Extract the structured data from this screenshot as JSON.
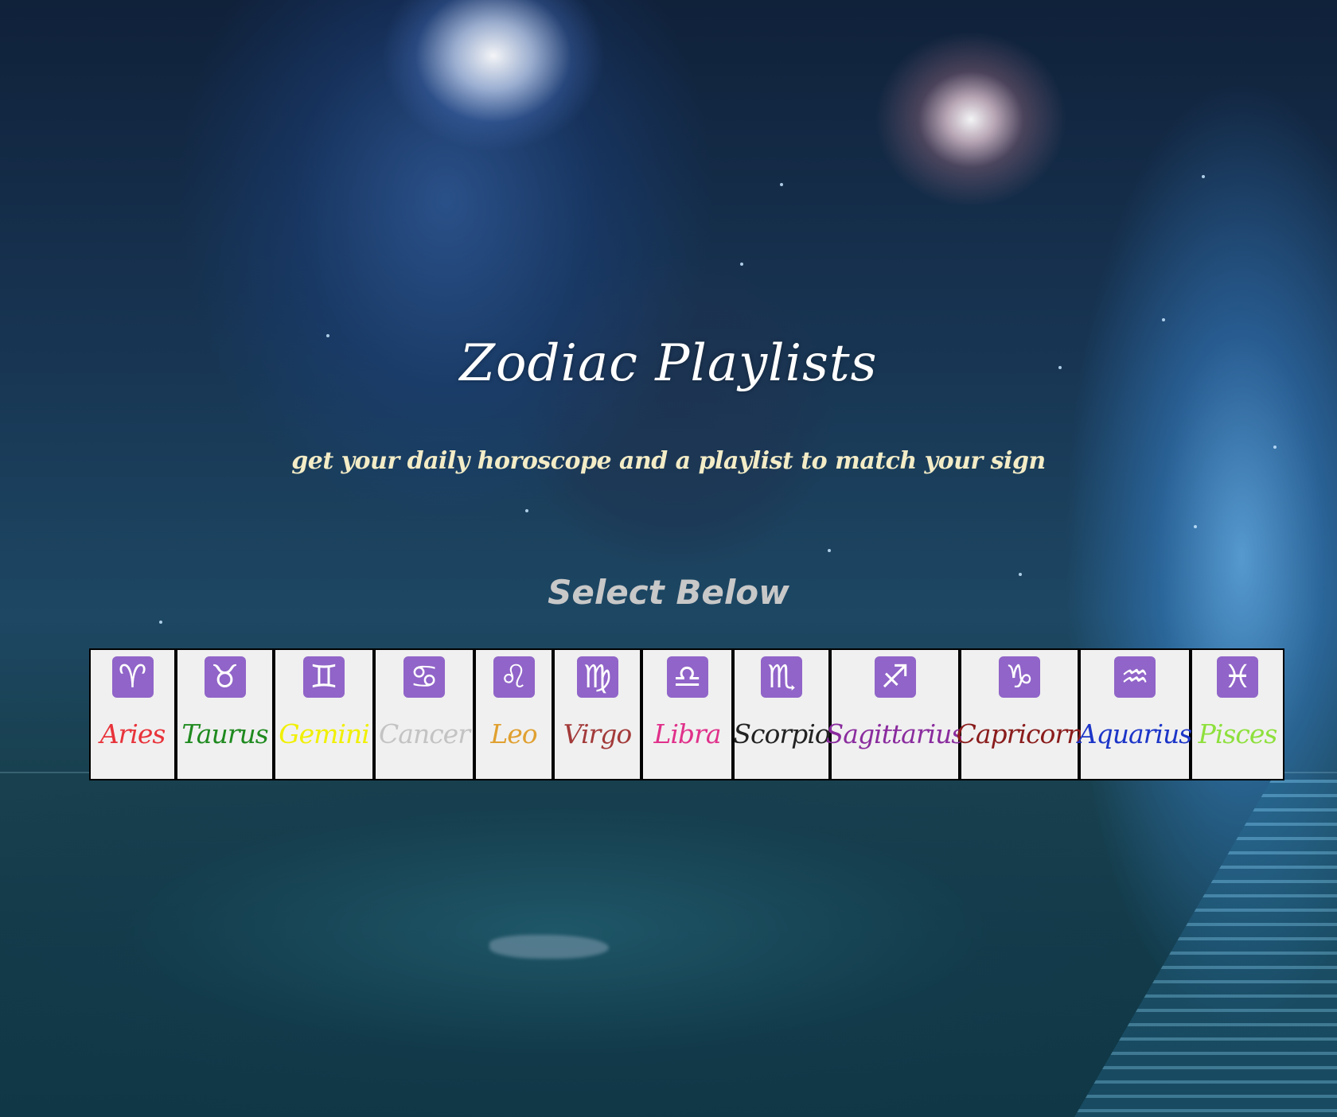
{
  "header": {
    "title": "Zodiac Playlists",
    "subtitle": "get your daily horoscope and a playlist to match your sign",
    "select_prompt": "Select Below"
  },
  "signs": [
    {
      "name": "Aries",
      "glyph": "♈",
      "color": "#e8333a"
    },
    {
      "name": "Taurus",
      "glyph": "♉",
      "color": "#1f8a1f"
    },
    {
      "name": "Gemini",
      "glyph": "♊",
      "color": "#f0f000"
    },
    {
      "name": "Cancer",
      "glyph": "♋",
      "color": "#c3c3c3"
    },
    {
      "name": "Leo",
      "glyph": "♌",
      "color": "#e0a030"
    },
    {
      "name": "Virgo",
      "glyph": "♍",
      "color": "#a33a3a"
    },
    {
      "name": "Libra",
      "glyph": "♎",
      "color": "#e0308a"
    },
    {
      "name": "Scorpio",
      "glyph": "♏",
      "color": "#222222"
    },
    {
      "name": "Sagittarius",
      "glyph": "♐",
      "color": "#8a2c9e"
    },
    {
      "name": "Capricorn",
      "glyph": "♑",
      "color": "#8a1c1c"
    },
    {
      "name": "Aquarius",
      "glyph": "♒",
      "color": "#1c35c8"
    },
    {
      "name": "Pisces",
      "glyph": "♓",
      "color": "#8ee03c"
    }
  ],
  "theme": {
    "glyph_tile_color": "#9064c8",
    "tile_background": "#f0f0f0"
  }
}
